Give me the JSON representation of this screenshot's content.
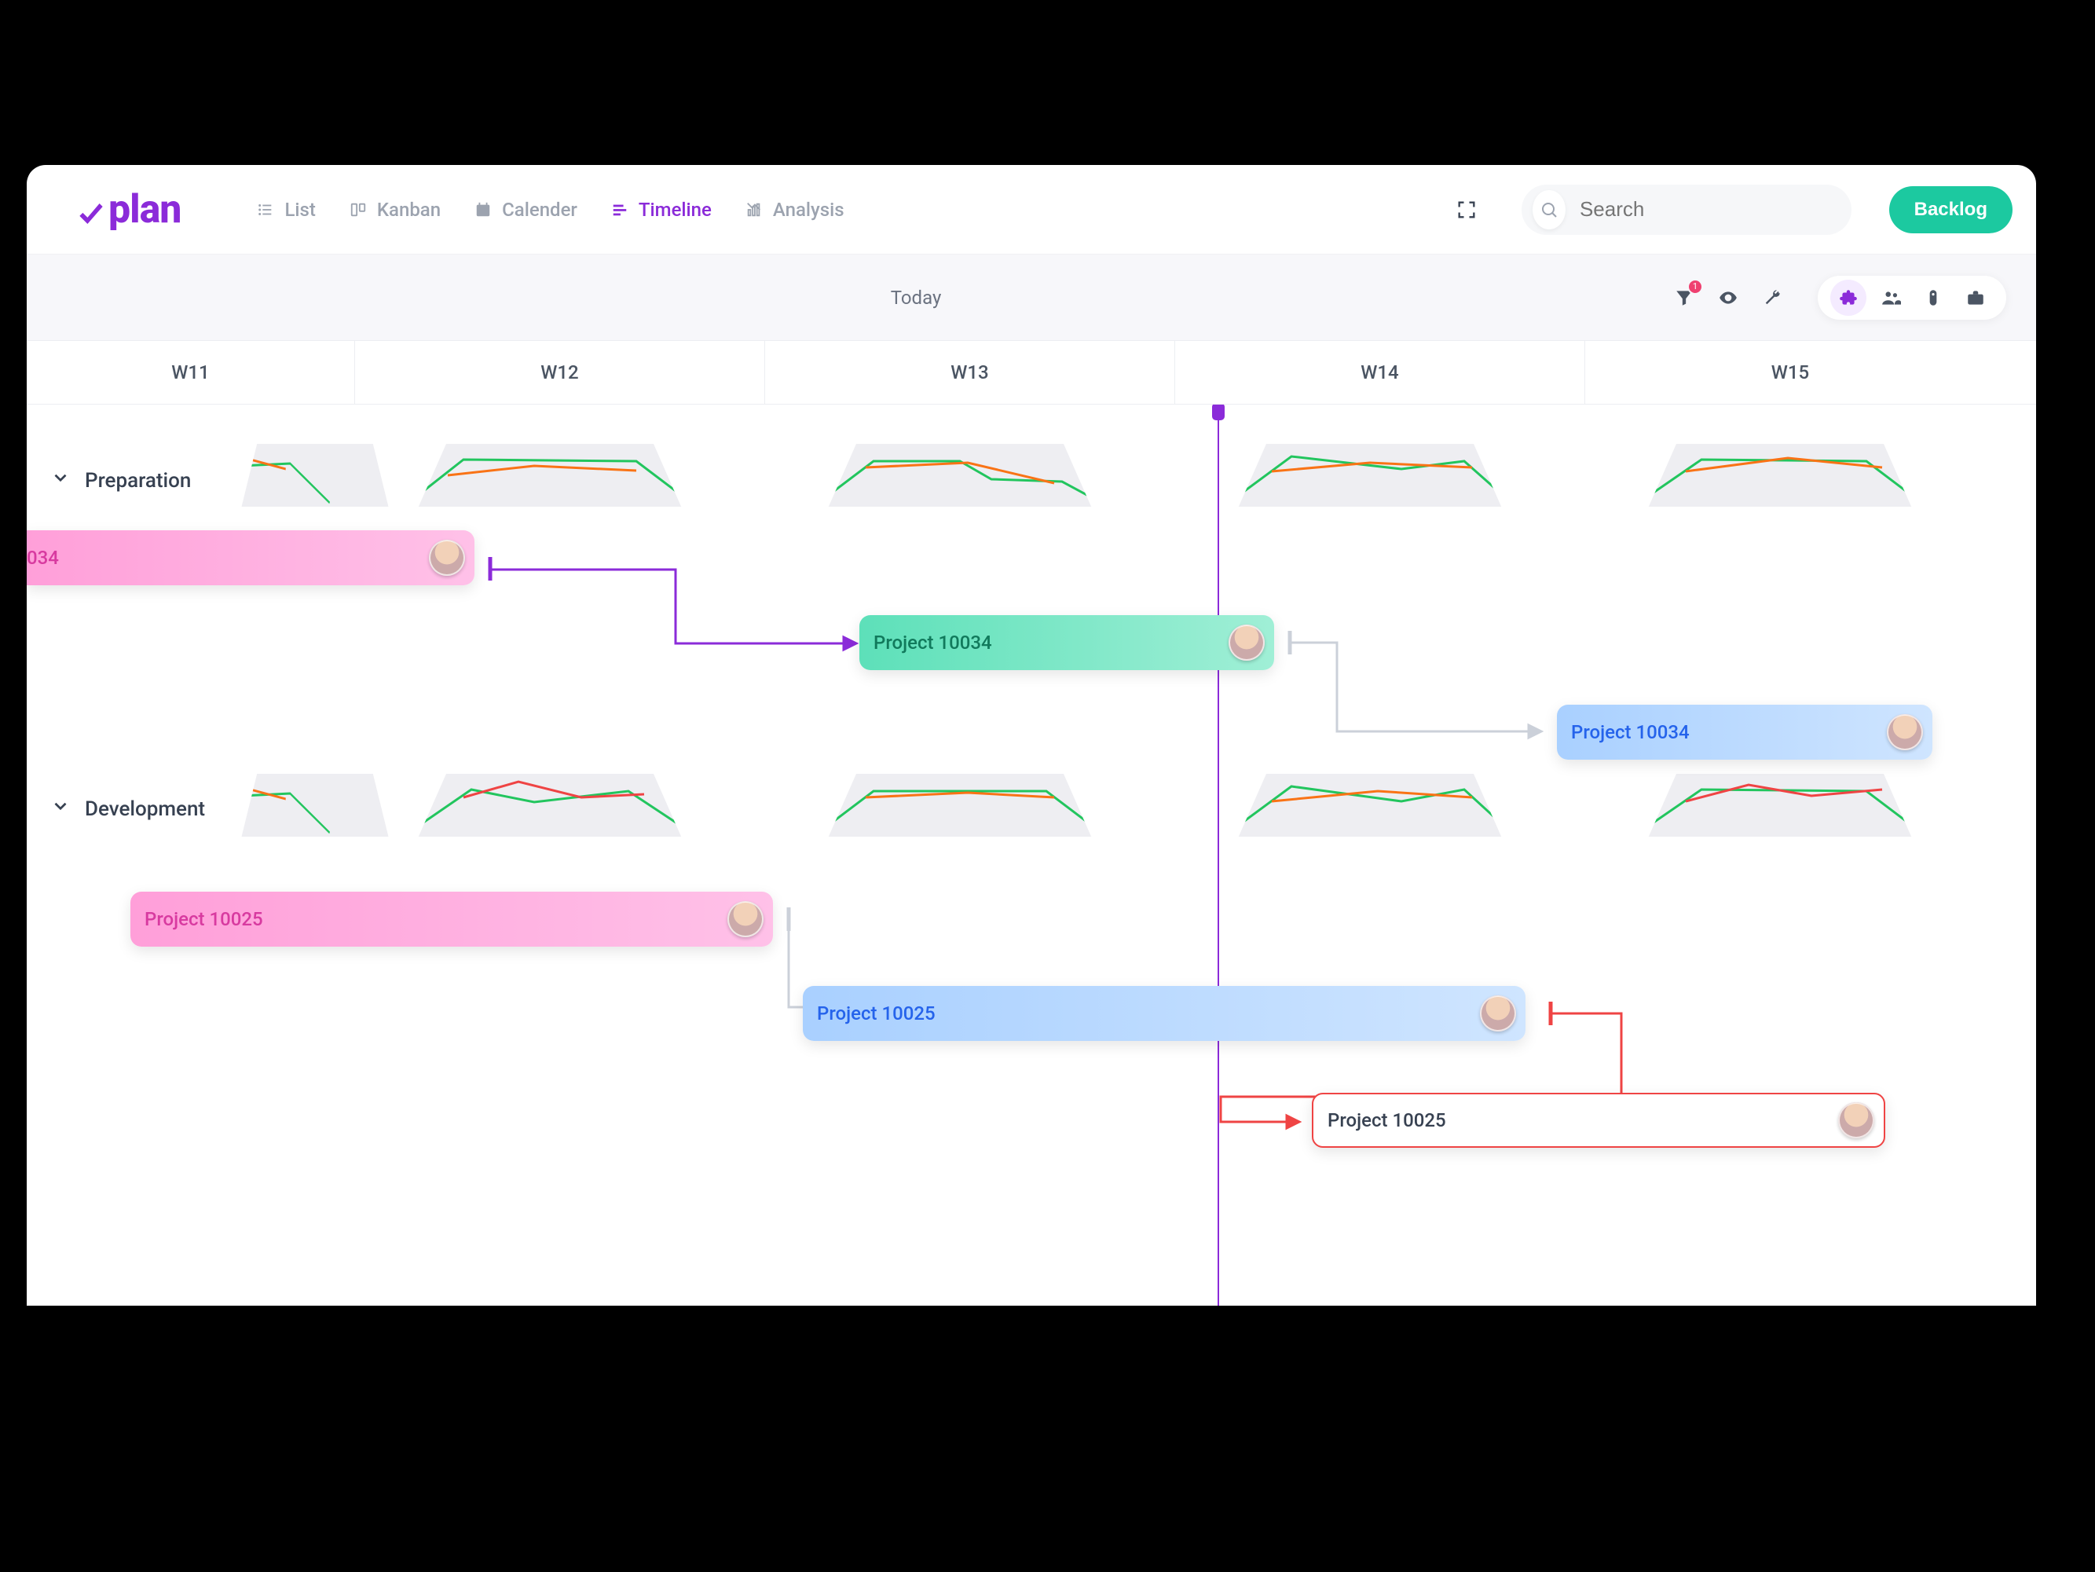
{
  "app": {
    "brand": "plan"
  },
  "views": {
    "list": "List",
    "kanban": "Kanban",
    "calendar": "Calender",
    "timeline": "Timeline",
    "analysis": "Analysis",
    "active": "timeline"
  },
  "search": {
    "placeholder": "Search"
  },
  "buttons": {
    "backlog": "Backlog"
  },
  "toolbar": {
    "today_label": "Today",
    "filter_badge": "1"
  },
  "weeks": [
    "W11",
    "W12",
    "W13",
    "W14",
    "W15"
  ],
  "groups": {
    "preparation": "Preparation",
    "development": "Development"
  },
  "tasks": {
    "a": "034",
    "b": "Project 10034",
    "c": "Project 10034",
    "d": "Project 10025",
    "e": "Project 10025",
    "f": "Project 10025"
  }
}
